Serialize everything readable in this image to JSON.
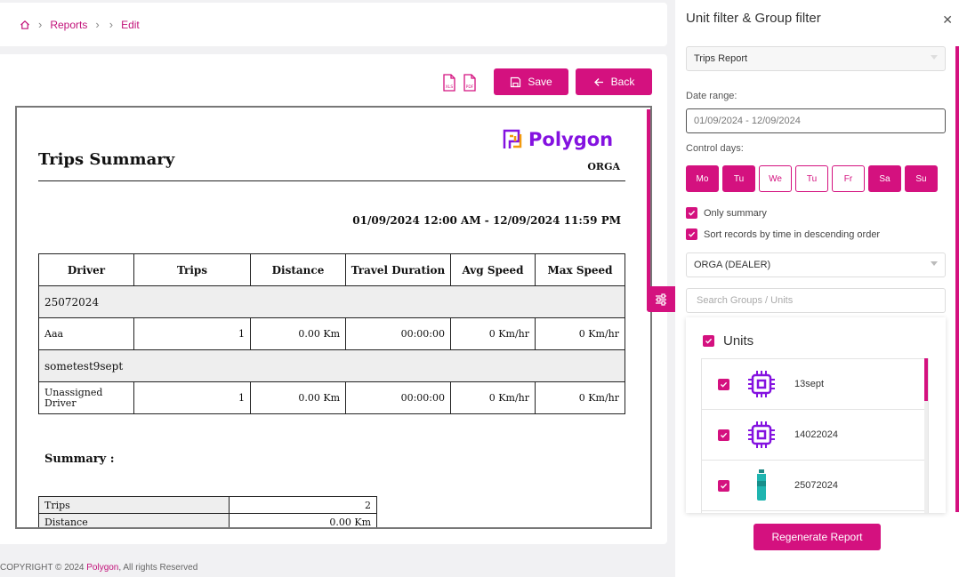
{
  "breadcrumb": {
    "reports": "Reports",
    "edit": "Edit"
  },
  "toolbar": {
    "save_label": "Save",
    "back_label": "Back",
    "xls_label": "XLS",
    "pdf_label": "PDF"
  },
  "report": {
    "title": "Trips Summary",
    "logo_text": "Polygon",
    "company": "ORGA",
    "date_range": "01/09/2024 12:00 AM - 12/09/2024 11:59 PM",
    "columns": [
      "Driver",
      "Trips",
      "Distance",
      "Travel Duration",
      "Avg Speed",
      "Max Speed"
    ],
    "groups": [
      {
        "name": "25072024",
        "row": [
          "Aaa",
          "1",
          "0.00 Km",
          "00:00:00",
          "0 Km/hr",
          "0 Km/hr"
        ]
      },
      {
        "name": "sometest9sept",
        "row": [
          "Unassigned Driver",
          "1",
          "0.00 Km",
          "00:00:00",
          "0 Km/hr",
          "0 Km/hr"
        ]
      }
    ],
    "summary_title": "Summary :",
    "summary": [
      {
        "label": "Trips",
        "value": "2"
      },
      {
        "label": "Distance",
        "value": "0.00 Km"
      }
    ]
  },
  "footer": {
    "copyright": "COPYRIGHT © 2024",
    "brand": "Polygon",
    "rights": ", All rights Reserved"
  },
  "panel": {
    "title": "Unit filter & Group filter",
    "report_type": "Trips Report",
    "date_label": "Date range:",
    "date_value": "01/09/2024 - 12/09/2024",
    "control_label": "Control days:",
    "days": [
      {
        "label": "Mo",
        "active": true
      },
      {
        "label": "Tu",
        "active": true
      },
      {
        "label": "We",
        "active": false
      },
      {
        "label": "Tu",
        "active": false
      },
      {
        "label": "Fr",
        "active": false
      },
      {
        "label": "Sa",
        "active": true
      },
      {
        "label": "Su",
        "active": true
      }
    ],
    "only_summary": "Only summary",
    "sort_desc": "Sort records by time in descending order",
    "dealer": "ORGA (DEALER)",
    "search_placeholder": "Search Groups / Units",
    "units_label": "Units",
    "units": [
      {
        "name": "13sept",
        "icon": "chip-icon"
      },
      {
        "name": "14022024",
        "icon": "chip-icon"
      },
      {
        "name": "25072024",
        "icon": "bottle-icon"
      }
    ],
    "regen_label": "Regenerate Report"
  },
  "colors": {
    "accent": "#d4117f",
    "logo": "#8412e0",
    "bottle": "#1fb5b0"
  }
}
